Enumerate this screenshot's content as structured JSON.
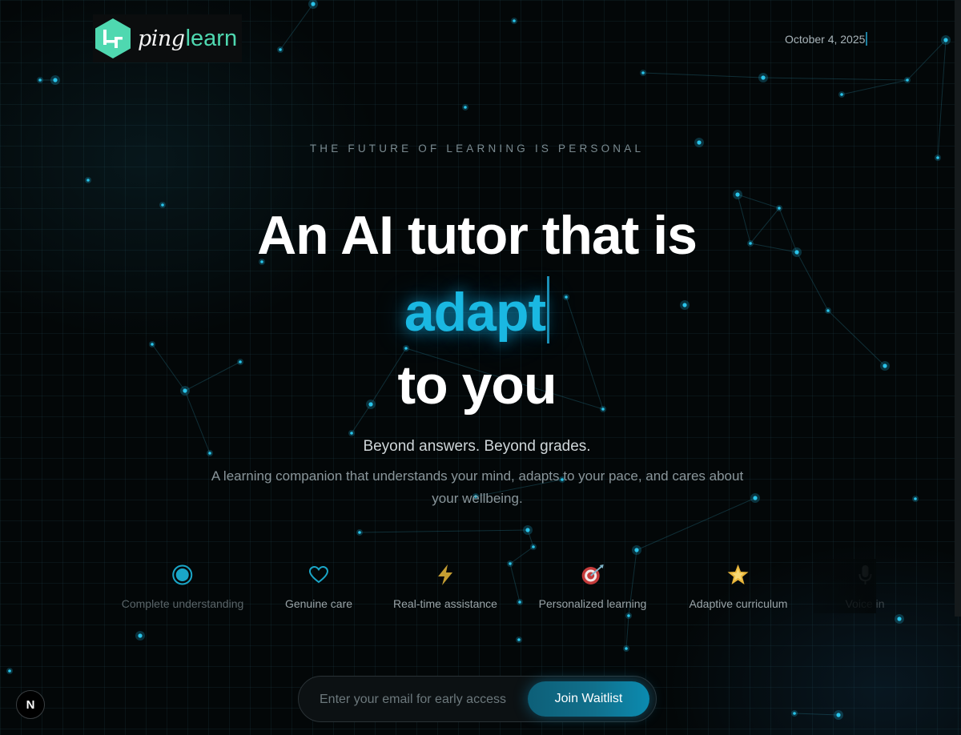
{
  "brand": {
    "name_part1": "ping",
    "name_part2": "learn",
    "accent": "#4fd8b0"
  },
  "header": {
    "date": "October 4, 2025"
  },
  "hero": {
    "eyebrow": "THE FUTURE OF LEARNING IS PERSONAL",
    "headline_line1": "An AI tutor that is",
    "headline_typed_word": "adapt",
    "headline_line3": "to you",
    "subheading": "Beyond answers. Beyond grades.",
    "description": "A learning companion that understands your mind, adapts to your pace, and cares about your wellbeing.",
    "highlight_color": "#1ab8e2"
  },
  "features": [
    {
      "label": "Complete understanding",
      "icon": "target-circle-icon"
    },
    {
      "label": "Genuine care",
      "icon": "heart-icon"
    },
    {
      "label": "Real-time assistance",
      "icon": "lightning-icon"
    },
    {
      "label": "Personalized learning",
      "icon": "dart-target-icon"
    },
    {
      "label": "Adaptive curriculum",
      "icon": "glowing-star-icon"
    },
    {
      "label": "Voice in",
      "icon": "microphone-icon"
    }
  ],
  "waitlist": {
    "email_placeholder": "Enter your email for early access",
    "button_label": "Join Waitlist"
  },
  "badge": {
    "label": "N"
  }
}
